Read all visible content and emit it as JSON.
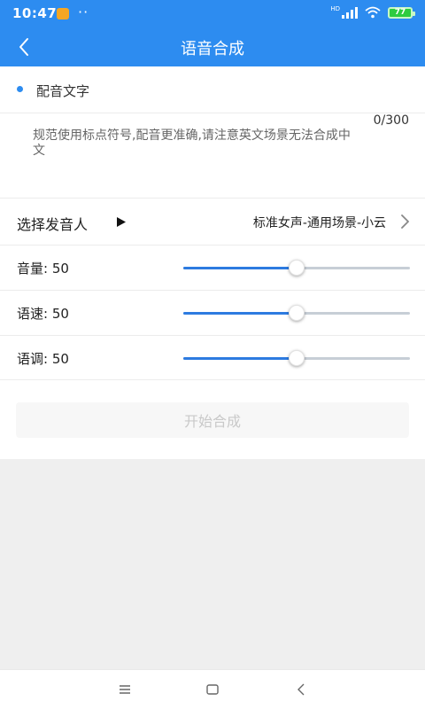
{
  "status_bar": {
    "time": "10:47",
    "dots": "··",
    "battery": "77",
    "notification_icon": "message-notification-icon",
    "signal_icon": "cellular-signal-icon",
    "wifi_icon": "wifi-icon",
    "battery_icon": "battery-icon"
  },
  "header": {
    "title": "语音合成",
    "back_icon": "back-arrow-icon"
  },
  "section_label": "配音文字",
  "text_input": {
    "counter": "0/300",
    "placeholder": "规范使用标点符号,配音更准确,请注意英文场景无法合成中文"
  },
  "speaker": {
    "label": "选择发音人",
    "play_icon": "play-icon",
    "value": "标准女声-通用场景-小云",
    "chevron_icon": "chevron-right-icon"
  },
  "sliders": [
    {
      "label": "音量: 50",
      "level": 0.5
    },
    {
      "label": "语速: 50",
      "level": 0.5
    },
    {
      "label": "语调: 50",
      "level": 0.5
    }
  ],
  "start_button": {
    "label": "开始合成"
  },
  "colors": {
    "primary": "#2d8cf0",
    "slider_fill": "#2d7be0",
    "slider_track": "#c7ced6",
    "button_disabled_bg": "#f7f7f7",
    "button_disabled_text": "#c9c9c9"
  },
  "nav_bar": {
    "menu_icon": "menu-icon",
    "home_icon": "home-icon",
    "back_icon": "back-icon"
  }
}
